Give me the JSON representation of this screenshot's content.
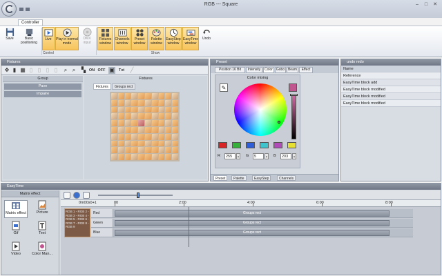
{
  "window": {
    "title": "RGB --- Square",
    "minimize": "–",
    "maximize": "□",
    "close": "✕"
  },
  "ribbon": {
    "tab": "Controller",
    "groups": [
      {
        "label": "Control"
      },
      {
        "label": "Show"
      }
    ],
    "buttons": [
      {
        "label": "Save",
        "icon": "floppy-disk-icon"
      },
      {
        "label": "Basic positioning",
        "icon": "positioning-icon"
      },
      {
        "label": "Live",
        "icon": "live-icon"
      },
      {
        "label": "Play in normal mode",
        "icon": "play-icon"
      },
      {
        "label": "DMX input",
        "icon": "dmx-input-icon"
      },
      {
        "label": "Fixtures window",
        "icon": "fixtures-icon"
      },
      {
        "label": "Channels window",
        "icon": "channels-icon"
      },
      {
        "label": "Preset window",
        "icon": "preset-icon"
      },
      {
        "label": "Palette window",
        "icon": "palette-icon"
      },
      {
        "label": "EasyStep window",
        "icon": "easystep-icon"
      },
      {
        "label": "EasyTime window",
        "icon": "easytime-icon"
      },
      {
        "label": "Undo",
        "icon": "undo-icon"
      }
    ]
  },
  "fixtures": {
    "title": "Fixtures",
    "toolbar": {
      "on": "ON",
      "off": "OFF",
      "txt": "Txt"
    },
    "group_header": "Group",
    "groups": [
      "Pave",
      "Impaire"
    ],
    "area_title": "Fixtures",
    "tabs": [
      "Fixtures",
      "Groups rect"
    ]
  },
  "preset": {
    "title": "Preset",
    "tabs": [
      "Position 16 Bit",
      "Intensity",
      "Color",
      "Gobo",
      "Beam",
      "Effect"
    ],
    "color_mixing_title": "Color mixing",
    "swatches": [
      "#d82424",
      "#35b03a",
      "#2f5fd8",
      "#3ec4cc",
      "#b04cb8",
      "#e6e032"
    ],
    "rgb": {
      "r_label": "R",
      "r": "255",
      "g_label": "G",
      "g": "5",
      "b_label": "B",
      "b": "203"
    },
    "current_color": "#c0558f",
    "bottom_tabs": [
      "Preset",
      "Palette",
      "EasyStep",
      "Channels"
    ]
  },
  "undo": {
    "title": "undo redo",
    "header": "Name",
    "rows": [
      "Reference",
      "EasyTime block add",
      "EasyTime block modified",
      "EasyTime block modified",
      "EasyTime block modified"
    ]
  },
  "easytime": {
    "title": "EasyTime",
    "left_tab": "Matrix effect",
    "effects": [
      {
        "label": "Matrix effect",
        "icon": "matrix-effect-icon"
      },
      {
        "label": "Picture",
        "icon": "picture-icon"
      },
      {
        "label": "Gif",
        "icon": "gif-icon"
      },
      {
        "label": "Text",
        "icon": "text-icon"
      },
      {
        "label": "Video",
        "icon": "video-icon"
      },
      {
        "label": "Color Man...",
        "icon": "color-manager-icon"
      }
    ],
    "zoom_label": "0m00s0+1",
    "ruler": [
      "00",
      "2:00",
      "4:00",
      "6:00",
      "8:00"
    ],
    "preview_text": "RGB 1 - RGB 2 - RGB 3 - RGB 4 - RGB 5 - RGB 6 - RGB 7 - RGB 8 - RGB 9",
    "tracks": [
      {
        "name": "Red",
        "clip": "Groups rect"
      },
      {
        "name": "Green",
        "clip": "Groups rect"
      },
      {
        "name": "Blue",
        "clip": "Groups rect"
      }
    ]
  }
}
